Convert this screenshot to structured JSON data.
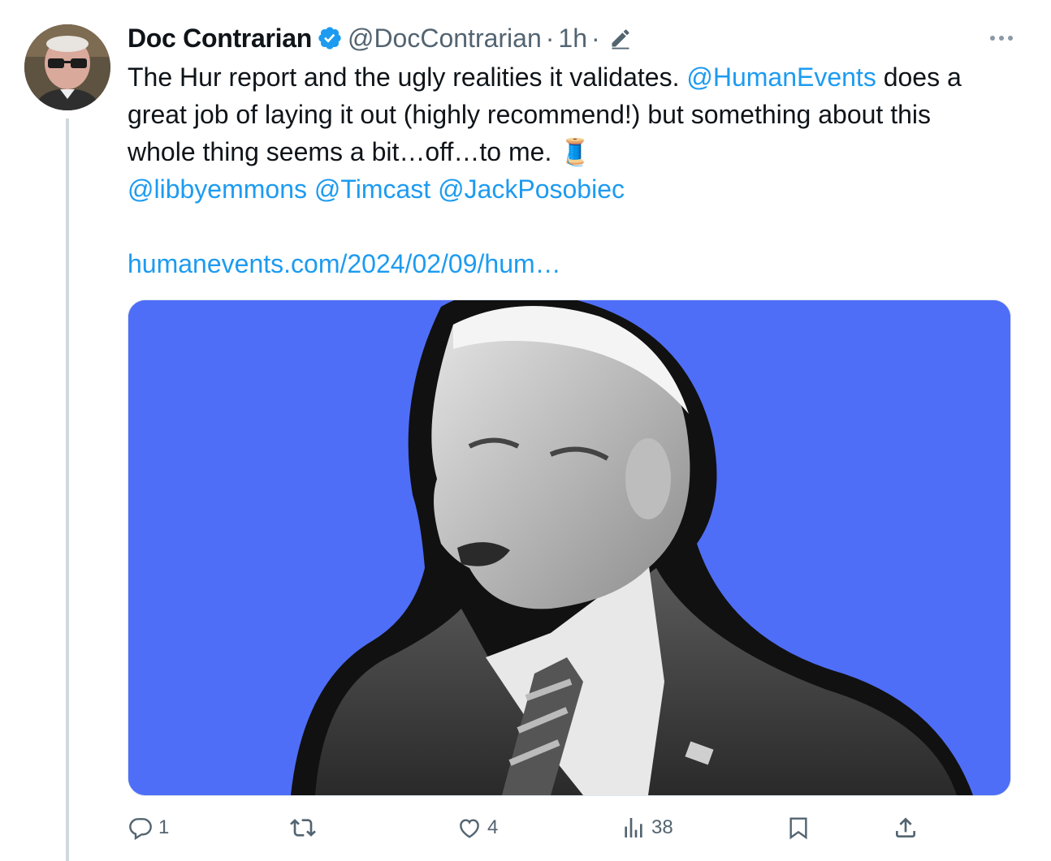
{
  "tweet": {
    "author_name": "Doc Contrarian",
    "handle": "@DocContrarian",
    "separator": "·",
    "time": "1h",
    "text_line1": "The Hur report and the ugly realities it validates. ",
    "mention_humanevents": "@HumanEvents",
    "text_line1_end": " does a",
    "text_line2": "great job of laying it out (highly recommend!) but something about this",
    "text_line3": "whole thing seems a bit…off…to me. 🧵",
    "mention_libbyemmons": "@libbyemmons",
    "mention_timcast": "@Timcast",
    "mention_jackposobiec": "@JackPosobiec",
    "link_url": "humanevents.com/2024/02/09/hum…"
  },
  "actions": {
    "reply_count": "1",
    "retweet_count": "",
    "like_count": "4",
    "views_count": "38"
  },
  "icons": {
    "verified": "verified-badge-icon",
    "edit": "edit-pencil-icon",
    "more": "more-options-icon",
    "reply": "reply-icon",
    "retweet": "retweet-icon",
    "like": "heart-icon",
    "views": "analytics-icon",
    "bookmark": "bookmark-icon",
    "share": "share-icon"
  },
  "colors": {
    "link": "#1d9bf0",
    "muted": "#536471",
    "media_background": "#4f6ef7"
  }
}
